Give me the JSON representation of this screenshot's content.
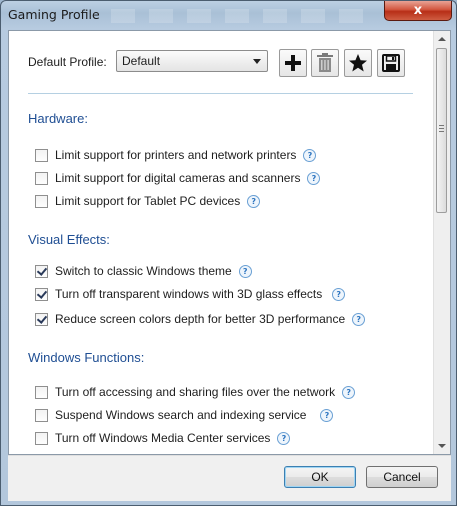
{
  "window": {
    "title": "Gaming Profile",
    "close_label": "x"
  },
  "profile": {
    "label": "Default Profile:",
    "selected": "Default",
    "icons": [
      "add-icon",
      "trash-icon",
      "star-icon",
      "save-icon"
    ]
  },
  "sections": {
    "hardware": {
      "title": "Hardware:",
      "options": [
        {
          "label": "Limit support for printers and network printers",
          "checked": false
        },
        {
          "label": "Limit support for digital cameras and scanners",
          "checked": false
        },
        {
          "label": "Limit support for Tablet PC devices",
          "checked": false
        }
      ]
    },
    "visual": {
      "title": "Visual Effects:",
      "options": [
        {
          "label": "Switch to classic Windows theme",
          "checked": true
        },
        {
          "label": "Turn off transparent windows with 3D glass effects",
          "checked": true
        },
        {
          "label": "Reduce screen colors depth for better 3D performance",
          "checked": true
        }
      ]
    },
    "windows": {
      "title": "Windows Functions:",
      "options": [
        {
          "label": "Turn off accessing and sharing files over the network",
          "checked": false
        },
        {
          "label": "Suspend Windows search and indexing service",
          "checked": false
        },
        {
          "label": "Turn off Windows Media Center services",
          "checked": false
        }
      ]
    }
  },
  "help_glyph": "?",
  "buttons": {
    "ok": "OK",
    "cancel": "Cancel"
  },
  "colors": {
    "section_title": "#1f4e93",
    "close_button": "#c8412a"
  }
}
